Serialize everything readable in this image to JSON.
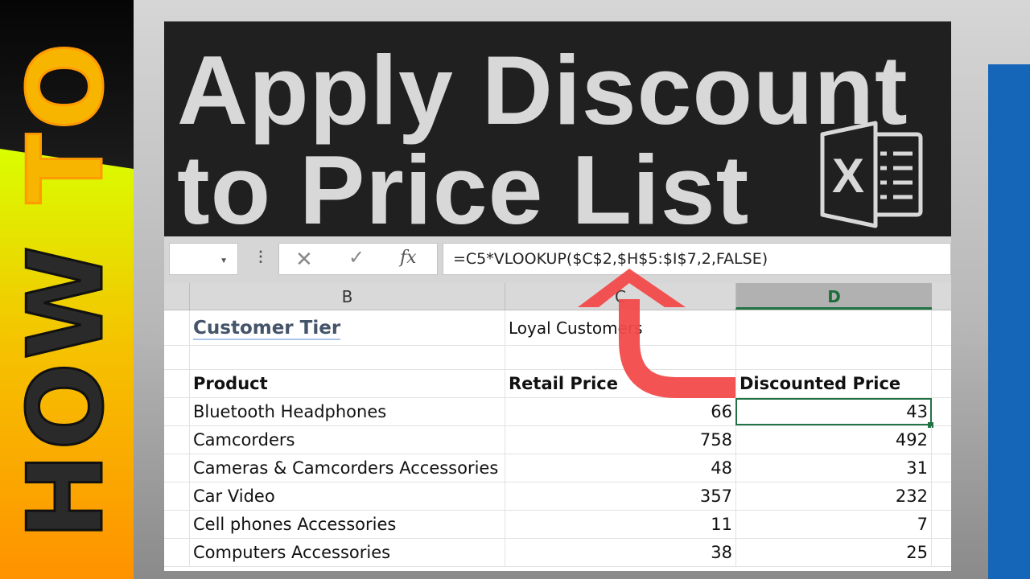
{
  "banner": {
    "how": "HOW",
    "to": "TO"
  },
  "title": {
    "line1": "Apply Discount",
    "line2": "to Price List"
  },
  "logo": {
    "icon": "excel-icon"
  },
  "colors": {
    "accent_green": "#217346",
    "arrow_red": "#f24a4a",
    "blue_strip": "#1565b9",
    "title_bg": "#202020"
  },
  "formula_bar": {
    "name_box": "",
    "cancel_icon": "✕",
    "enter_icon": "✓",
    "fx_label": "fx",
    "formula": "=C5*VLOOKUP($C$2,$H$5:$I$7,2,FALSE)"
  },
  "columns": [
    {
      "label": "B"
    },
    {
      "label": "C"
    },
    {
      "label": "D",
      "selected": true
    }
  ],
  "sheet": {
    "tier_label": "Customer Tier",
    "tier_value": "Loyal Customers",
    "headers": {
      "product": "Product",
      "retail": "Retail Price",
      "discounted": "Discounted Price"
    },
    "rows": [
      {
        "product": "Bluetooth Headphones",
        "retail": "66",
        "discounted": "43"
      },
      {
        "product": "Camcorders",
        "retail": "758",
        "discounted": "492"
      },
      {
        "product": "Cameras & Camcorders Accessories",
        "retail": "48",
        "discounted": "31"
      },
      {
        "product": "Car Video",
        "retail": "357",
        "discounted": "232"
      },
      {
        "product": "Cell phones Accessories",
        "retail": "11",
        "discounted": "7"
      },
      {
        "product": "Computers Accessories",
        "retail": "38",
        "discounted": "25"
      }
    ]
  }
}
